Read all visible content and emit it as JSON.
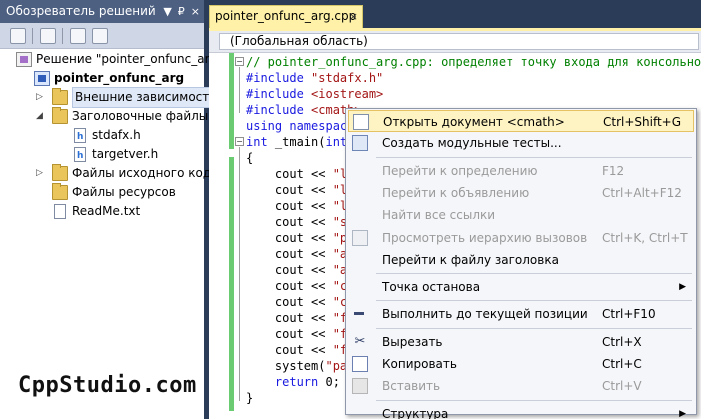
{
  "solution_explorer": {
    "title": "Обозреватель решений",
    "header_buttons": [
      "▼",
      "₽",
      "×"
    ],
    "tree": [
      {
        "label": "Решение \"pointer_onfunc_arg\"",
        "icon": "solution-icon"
      },
      {
        "label": "pointer_onfunc_arg",
        "icon": "project-icon",
        "bold": true
      },
      {
        "label": "Внешние зависимости",
        "icon": "folder-icon",
        "expander": "▷"
      },
      {
        "label": "Заголовочные файлы",
        "icon": "folder-icon",
        "expander": "◢"
      },
      {
        "label": "stdafx.h",
        "icon": "header-file-icon"
      },
      {
        "label": "targetver.h",
        "icon": "header-file-icon"
      },
      {
        "label": "Файлы исходного кода",
        "icon": "folder-icon",
        "expander": "▷"
      },
      {
        "label": "Файлы ресурсов",
        "icon": "folder-icon"
      },
      {
        "label": "ReadMe.txt",
        "icon": "file-icon"
      }
    ]
  },
  "watermark": "CppStudio.com",
  "editor": {
    "tab_label": "pointer_onfunc_arg.cpp",
    "tab_close": "×",
    "scope": "(Глобальная область)",
    "lines": [
      [
        {
          "c": "cm",
          "t": "// pointer_onfunc_arg.cpp: определяет точку входа для консольного"
        }
      ],
      [
        {
          "c": "kw",
          "t": "#include "
        },
        {
          "c": "st",
          "t": "\"stdafx.h\""
        }
      ],
      [
        {
          "c": "kw",
          "t": "#include "
        },
        {
          "c": "st",
          "t": "<iostream>"
        }
      ],
      [
        {
          "c": "kw",
          "t": "#include "
        },
        {
          "c": "st",
          "t": "<cmath>"
        }
      ],
      [
        {
          "c": "kw",
          "t": "using "
        },
        {
          "c": "kw",
          "t": "namespac"
        }
      ],
      [
        {
          "c": "kw",
          "t": "int"
        },
        {
          "c": "tx-b",
          "t": " _tmain("
        },
        {
          "c": "kw",
          "t": "int"
        }
      ],
      [
        {
          "c": "tx-b",
          "t": "{"
        }
      ],
      [
        {
          "c": "tx-b",
          "t": "    cout << "
        },
        {
          "c": "st",
          "t": "\"l"
        }
      ],
      [
        {
          "c": "tx-b",
          "t": "    cout << "
        },
        {
          "c": "st",
          "t": "\"l"
        }
      ],
      [
        {
          "c": "tx-b",
          "t": "    cout << "
        },
        {
          "c": "st",
          "t": "\"l"
        }
      ],
      [
        {
          "c": "tx-b",
          "t": "    cout << "
        },
        {
          "c": "st",
          "t": "\"s"
        }
      ],
      [
        {
          "c": "tx-b",
          "t": "    cout << "
        },
        {
          "c": "st",
          "t": "\"p"
        }
      ],
      [
        {
          "c": "tx-b",
          "t": "    cout << "
        },
        {
          "c": "st",
          "t": "\"a"
        }
      ],
      [
        {
          "c": "tx-b",
          "t": "    cout << "
        },
        {
          "c": "st",
          "t": "\"a"
        }
      ],
      [
        {
          "c": "tx-b",
          "t": "    cout << "
        },
        {
          "c": "st",
          "t": "\"c"
        }
      ],
      [
        {
          "c": "tx-b",
          "t": "    cout << "
        },
        {
          "c": "st",
          "t": "\"c"
        }
      ],
      [
        {
          "c": "tx-b",
          "t": "    cout << "
        },
        {
          "c": "st",
          "t": "\"f"
        }
      ],
      [
        {
          "c": "tx-b",
          "t": "    cout << "
        },
        {
          "c": "st",
          "t": "\"f"
        }
      ],
      [
        {
          "c": "tx-b",
          "t": "    cout << "
        },
        {
          "c": "st",
          "t": "\"f"
        }
      ],
      [
        {
          "c": "tx-b",
          "t": "    system("
        },
        {
          "c": "st",
          "t": "\"pa"
        }
      ],
      [
        {
          "c": "tx-b",
          "t": "    "
        },
        {
          "c": "kw",
          "t": "return"
        },
        {
          "c": "tx-b",
          "t": " 0;"
        }
      ],
      [
        {
          "c": "tx-b",
          "t": "}"
        }
      ]
    ],
    "fold_glyph": "−"
  },
  "context_menu": {
    "items": [
      {
        "label": "Открыть документ <cmath>",
        "shortcut": "Ctrl+Shift+G",
        "icon": "open-document-icon",
        "highlighted": true
      },
      {
        "label": "Создать модульные тесты...",
        "shortcut": "",
        "icon": "unit-test-icon"
      },
      {
        "separator": true
      },
      {
        "label": "Перейти к определению",
        "shortcut": "F12",
        "disabled": true
      },
      {
        "label": "Перейти к объявлению",
        "shortcut": "Ctrl+Alt+F12",
        "disabled": true
      },
      {
        "label": "Найти все ссылки",
        "shortcut": "",
        "disabled": true
      },
      {
        "label": "Просмотреть иерархию вызовов",
        "shortcut": "Ctrl+K, Ctrl+T",
        "disabled": true,
        "icon": "call-hierarchy-icon"
      },
      {
        "label": "Перейти к файлу заголовка",
        "shortcut": ""
      },
      {
        "separator": true
      },
      {
        "label": "Точка останова",
        "shortcut": "",
        "submenu": "▶"
      },
      {
        "separator": true
      },
      {
        "label": "Выполнить до текущей позиции",
        "shortcut": "Ctrl+F10",
        "icon": "run-to-cursor-icon"
      },
      {
        "separator": true
      },
      {
        "label": "Вырезать",
        "shortcut": "Ctrl+X",
        "icon": "cut-icon"
      },
      {
        "label": "Копировать",
        "shortcut": "Ctrl+C",
        "icon": "copy-icon"
      },
      {
        "label": "Вставить",
        "shortcut": "Ctrl+V",
        "disabled": true,
        "icon": "paste-icon"
      },
      {
        "separator": true
      },
      {
        "label": "Структура",
        "shortcut": "",
        "submenu": "▶"
      }
    ]
  }
}
